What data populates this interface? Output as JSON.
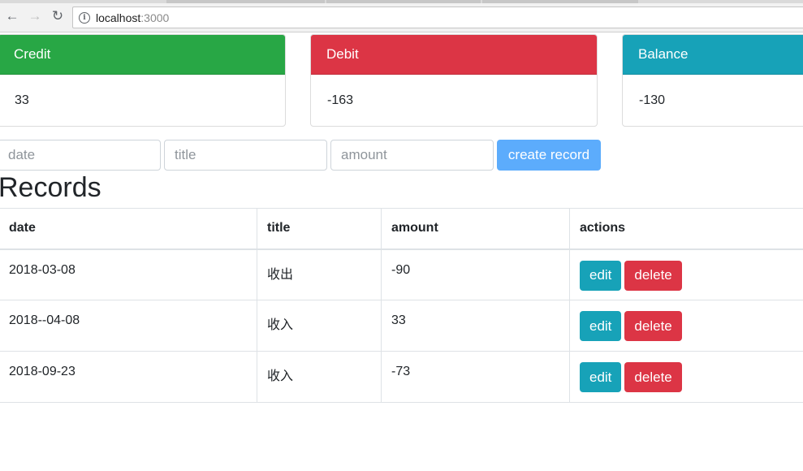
{
  "browser": {
    "url_host": "localhost",
    "url_port": ":3000",
    "back_glyph": "←",
    "forward_glyph": "→",
    "reload_glyph": "↻",
    "info_glyph": "i"
  },
  "summary": {
    "credit": {
      "label": "Credit",
      "value": "33",
      "color": "#28a745"
    },
    "debit": {
      "label": "Debit",
      "value": "-163",
      "color": "#dc3545"
    },
    "balance": {
      "label": "Balance",
      "value": "-130",
      "color": "#17a2b8"
    }
  },
  "form": {
    "date_placeholder": "date",
    "title_placeholder": "title",
    "amount_placeholder": "amount",
    "submit_label": "create record",
    "submit_color": "#5cacfc"
  },
  "records": {
    "heading": "Records",
    "columns": [
      "date",
      "title",
      "amount",
      "actions"
    ],
    "rows": [
      {
        "date": "2018-03-08",
        "title": "收出",
        "amount": "-90"
      },
      {
        "date": "2018--04-08",
        "title": "收入",
        "amount": "33"
      },
      {
        "date": "2018-09-23",
        "title": "收入",
        "amount": "-73"
      }
    ],
    "edit_label": "edit",
    "delete_label": "delete",
    "edit_color": "#17a2b8",
    "delete_color": "#dc3545"
  }
}
